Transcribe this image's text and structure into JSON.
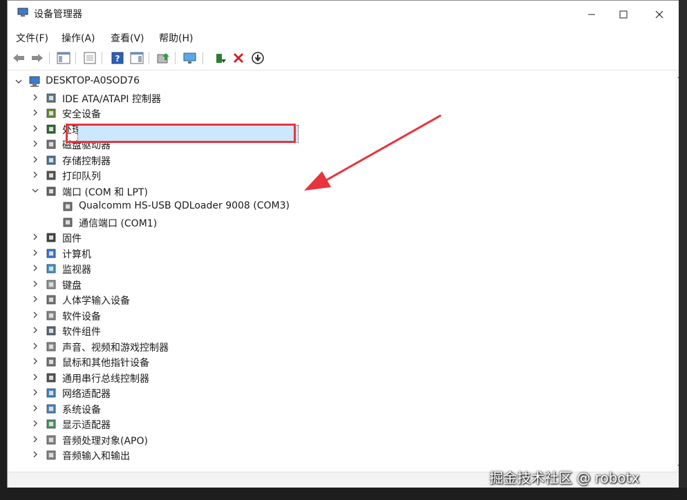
{
  "window": {
    "title": "设备管理器"
  },
  "menu": [
    {
      "label": "文件(F)"
    },
    {
      "label": "操作(A)"
    },
    {
      "label": "查看(V)"
    },
    {
      "label": "帮助(H)"
    }
  ],
  "tree": {
    "root": "DESKTOP-A0SOD76",
    "categories": [
      {
        "label": "IDE ATA/ATAPI 控制器",
        "icon": "ide-controller-icon"
      },
      {
        "label": "安全设备",
        "icon": "security-device-icon"
      },
      {
        "label": "处理器",
        "icon": "processor-icon"
      },
      {
        "label": "磁盘驱动器",
        "icon": "disk-drive-icon"
      },
      {
        "label": "存储控制器",
        "icon": "storage-controller-icon"
      },
      {
        "label": "打印队列",
        "icon": "printer-icon"
      },
      {
        "label": "端口 (COM 和 LPT)",
        "icon": "port-icon"
      },
      {
        "label": "固件",
        "icon": "firmware-icon"
      },
      {
        "label": "计算机",
        "icon": "computer-icon"
      },
      {
        "label": "监视器",
        "icon": "monitor-icon"
      },
      {
        "label": "键盘",
        "icon": "keyboard-icon"
      },
      {
        "label": "人体学输入设备",
        "icon": "hid-icon"
      },
      {
        "label": "软件设备",
        "icon": "software-device-icon"
      },
      {
        "label": "软件组件",
        "icon": "software-component-icon"
      },
      {
        "label": "声音、视频和游戏控制器",
        "icon": "sound-icon"
      },
      {
        "label": "鼠标和其他指针设备",
        "icon": "mouse-icon"
      },
      {
        "label": "通用串行总线控制器",
        "icon": "usb-icon"
      },
      {
        "label": "网络适配器",
        "icon": "network-adapter-icon"
      },
      {
        "label": "系统设备",
        "icon": "system-device-icon"
      },
      {
        "label": "显示适配器",
        "icon": "display-adapter-icon"
      },
      {
        "label": "音频处理对象(APO)",
        "icon": "apo-icon"
      },
      {
        "label": "音频输入和输出",
        "icon": "audio-io-icon"
      }
    ],
    "ports_children": [
      {
        "label": "Qualcomm HS-USB QDLoader 9008 (COM3)"
      },
      {
        "label": "通信端口 (COM1)"
      }
    ]
  },
  "watermark": "掘金技术社区 @ robotx",
  "colors": {
    "highlight_box": "#e8343c",
    "selection": "#cce8ff"
  }
}
